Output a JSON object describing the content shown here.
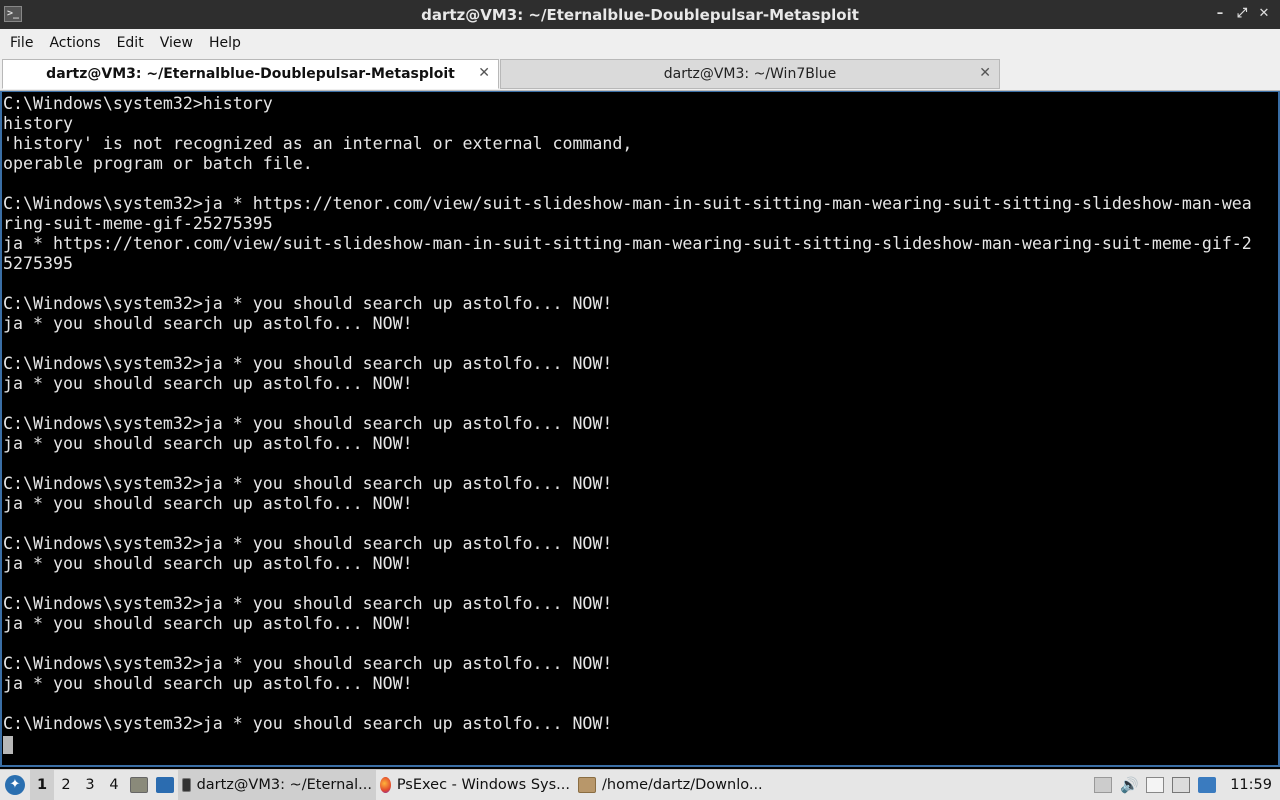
{
  "window": {
    "title": "dartz@VM3: ~/Eternalblue-Doublepulsar-Metasploit",
    "controls": [
      "–",
      "⤢",
      "✕"
    ]
  },
  "menu": [
    "File",
    "Actions",
    "Edit",
    "View",
    "Help"
  ],
  "tabs": [
    {
      "label": "dartz@VM3: ~/Eternalblue-Doublepulsar-Metasploit",
      "active": true
    },
    {
      "label": "dartz@VM3: ~/Win7Blue",
      "active": false
    }
  ],
  "terminal": {
    "lines": [
      "C:\\Windows\\system32>history",
      "history",
      "'history' is not recognized as an internal or external command,",
      "operable program or batch file.",
      "",
      "C:\\Windows\\system32>ja * https://tenor.com/view/suit-slideshow-man-in-suit-sitting-man-wearing-suit-sitting-slideshow-man-wea",
      "ring-suit-meme-gif-25275395",
      "ja * https://tenor.com/view/suit-slideshow-man-in-suit-sitting-man-wearing-suit-sitting-slideshow-man-wearing-suit-meme-gif-2",
      "5275395",
      "",
      "C:\\Windows\\system32>ja * you should search up astolfo... NOW!",
      "ja * you should search up astolfo... NOW!",
      "",
      "C:\\Windows\\system32>ja * you should search up astolfo... NOW!",
      "ja * you should search up astolfo... NOW!",
      "",
      "C:\\Windows\\system32>ja * you should search up astolfo... NOW!",
      "ja * you should search up astolfo... NOW!",
      "",
      "C:\\Windows\\system32>ja * you should search up astolfo... NOW!",
      "ja * you should search up astolfo... NOW!",
      "",
      "C:\\Windows\\system32>ja * you should search up astolfo... NOW!",
      "ja * you should search up astolfo... NOW!",
      "",
      "C:\\Windows\\system32>ja * you should search up astolfo... NOW!",
      "ja * you should search up astolfo... NOW!",
      "",
      "C:\\Windows\\system32>ja * you should search up astolfo... NOW!",
      "ja * you should search up astolfo... NOW!",
      "",
      "C:\\Windows\\system32>ja * you should search up astolfo... NOW!"
    ]
  },
  "taskbar": {
    "workspaces": [
      "1",
      "2",
      "3",
      "4"
    ],
    "tasks": [
      {
        "label": "dartz@VM3: ~/Eternal...",
        "icon": "terminal-icon",
        "active": true
      },
      {
        "label": "PsExec - Windows Sys...",
        "icon": "firefox-icon",
        "active": false
      },
      {
        "label": "/home/dartz/Downlo...",
        "icon": "archive-icon",
        "active": false
      }
    ],
    "clock": "11:59"
  },
  "colors": {
    "terminal_bg": "#000000",
    "terminal_fg": "#e6e6e6",
    "focus_border": "#3a6ea5"
  }
}
